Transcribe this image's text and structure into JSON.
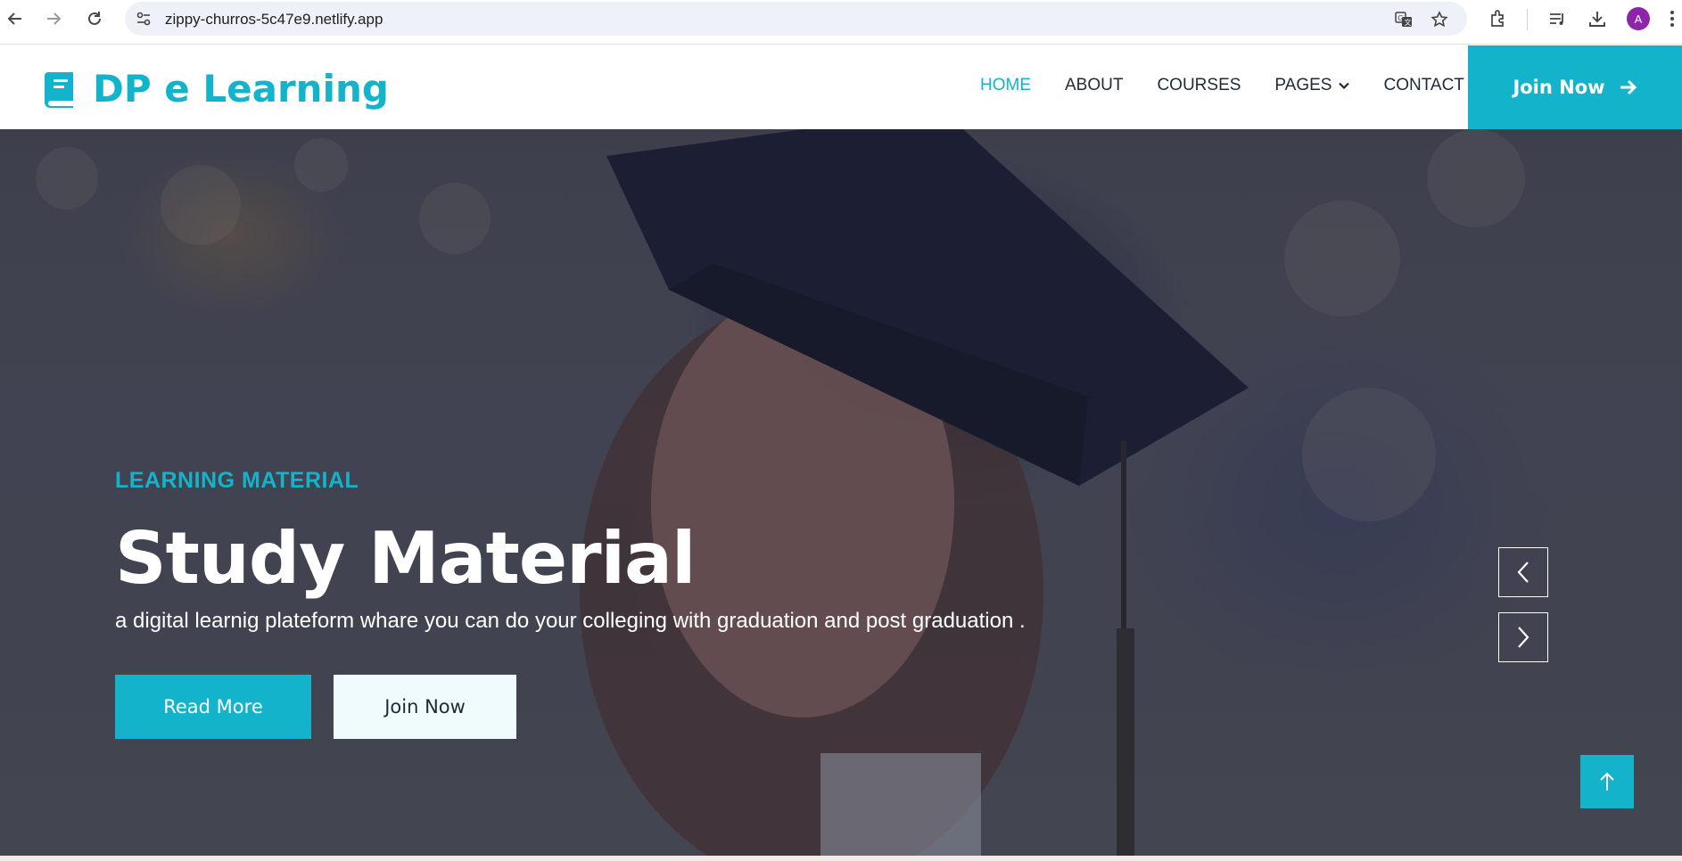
{
  "browser": {
    "url": "zippy-churros-5c47e9.netlify.app",
    "profile_initial": "A"
  },
  "navbar": {
    "brand": "DP e Learning",
    "links": [
      {
        "label": "HOME",
        "active": true
      },
      {
        "label": "ABOUT"
      },
      {
        "label": "COURSES"
      },
      {
        "label": "PAGES"
      },
      {
        "label": "CONTACT"
      }
    ],
    "join_label": "Join Now"
  },
  "hero": {
    "eyebrow": "LEARNING MATERIAL",
    "title": "Study Material",
    "subtitle": "a digital learnig plateform whare you can do your colleging with graduation and post graduation .",
    "read_more_label": "Read More",
    "join_label": "Join Now"
  },
  "colors": {
    "accent": "#13b4cb",
    "text_dark": "#1e2a38"
  },
  "icons": [
    "back-arrow-icon",
    "forward-arrow-icon",
    "reload-icon",
    "site-info-icon",
    "translate-icon",
    "bookmark-star-icon",
    "extensions-icon",
    "reading-list-icon",
    "download-icon",
    "menu-dots-icon",
    "book-icon",
    "chevron-down-icon",
    "arrow-right-icon",
    "chevron-left-icon",
    "chevron-right-icon",
    "arrow-up-icon"
  ]
}
